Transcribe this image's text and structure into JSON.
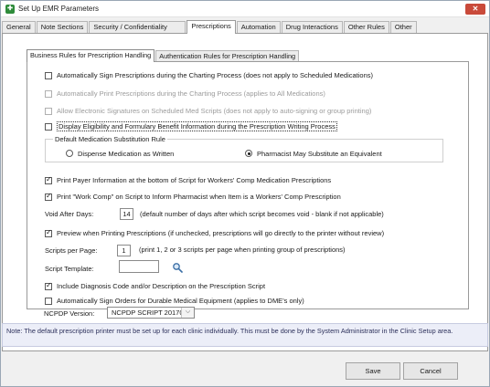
{
  "window": {
    "title": "Set Up EMR Parameters",
    "close_label": "✕"
  },
  "tabs": [
    "General",
    "Note Sections",
    "Security / Confidentiality",
    "Prescriptions",
    "Automation",
    "Drug Interactions",
    "Other Rules",
    "Other"
  ],
  "active_tab": "Prescriptions",
  "subtabs": [
    "Business Rules for Prescription Handling",
    "Authentication Rules for Prescription Handling"
  ],
  "active_subtab": "Business Rules for Prescription Handling",
  "rules": {
    "auto_sign": {
      "label": "Automatically Sign Prescriptions during the Charting Process (does not apply to Scheduled Medications)",
      "checked": false,
      "enabled": true
    },
    "auto_print": {
      "label": "Automatically Print Prescriptions during the Charting Process (applies to All Medications)",
      "checked": false,
      "enabled": false
    },
    "allow_esig": {
      "label": "Allow Electronic Signatures on Scheduled Med Scripts (does not apply to auto-signing or group printing)",
      "checked": false,
      "enabled": false
    },
    "display_eligibility": {
      "label": "Display Eligibility and Formulary Benefit Information during the Prescription Writing Process",
      "checked": false,
      "enabled": true
    }
  },
  "substitution": {
    "title": "Default Medication Substitution Rule",
    "options": [
      "Dispense Medication as Written",
      "Pharmacist May Substitute an Equivalent"
    ],
    "selected": "Pharmacist May Substitute an Equivalent"
  },
  "print_payer": {
    "label": "Print Payer Information at the bottom of Script for Workers' Comp Medication Prescriptions",
    "checked": true
  },
  "print_workcomp": {
    "label": "Print \"Work Comp\" on Script to Inform Pharmacist when Item is a Workers' Comp Prescription",
    "checked": true
  },
  "void_after": {
    "label": "Void After Days:",
    "value": "14",
    "hint": "(default number of days after which script becomes void - blank if not applicable)"
  },
  "preview": {
    "label": "Preview when Printing Prescriptions (if unchecked, prescriptions will go directly to the printer without review)",
    "checked": true
  },
  "scripts_per_page": {
    "label": "Scripts per Page:",
    "value": "1",
    "hint": "(print 1, 2 or 3 scripts per page when printing group of prescriptions)"
  },
  "script_template": {
    "label": "Script Template:",
    "value": ""
  },
  "include_diagnosis": {
    "label": "Include Diagnosis Code and/or Description on the Prescription Script",
    "checked": true
  },
  "auto_sign_dme": {
    "label": "Automatically Sign Orders for Durable Medical Equipment (applies to DME's only)",
    "checked": false
  },
  "ncpdp": {
    "label": "NCPDP Version:",
    "value": "NCPDP SCRIPT 2017071"
  },
  "note": "Note: The default prescription printer must be set up for each clinic individually. This must be done by the System Administrator  in the Clinic Setup area.",
  "buttons": {
    "save": "Save",
    "cancel": "Cancel"
  },
  "colors": {
    "titlebar_close": "#c94a3a",
    "note_bg": "#eceef8",
    "app_icon": "#2e8b3a"
  }
}
